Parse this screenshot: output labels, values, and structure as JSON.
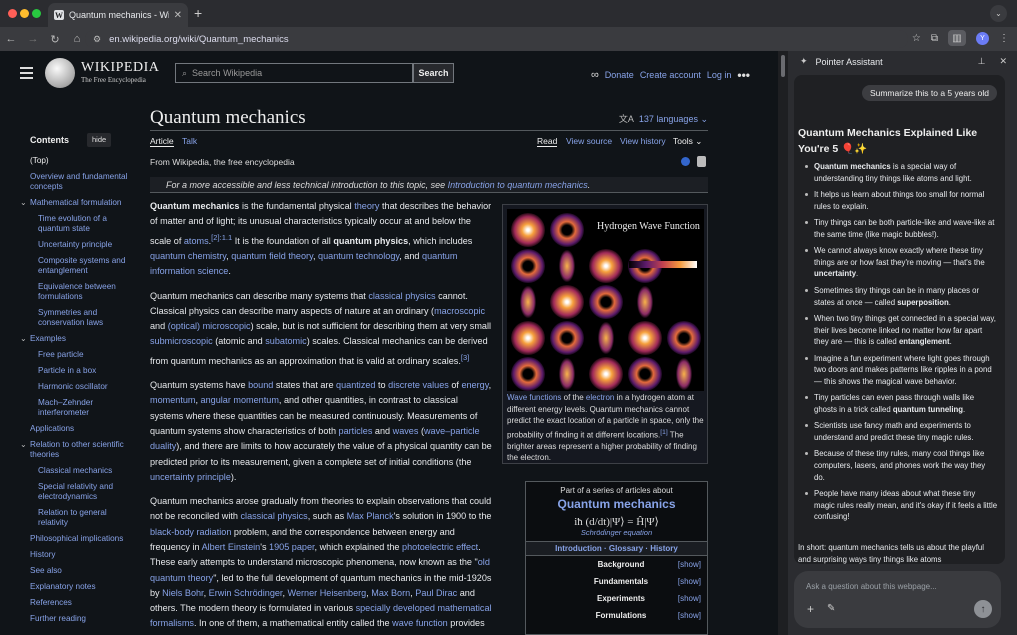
{
  "browser": {
    "tab_title": "Quantum mechanics - Wikipedia",
    "url": "en.wikipedia.org/wiki/Quantum_mechanics",
    "avatar_letter": "Y"
  },
  "wiki": {
    "wordmark": "WIKIPEDIA",
    "tagline": "The Free Encyclopedia",
    "search_placeholder": "Search Wikipedia",
    "search_button": "Search",
    "donate": "Donate",
    "create_account": "Create account",
    "login": "Log in",
    "contents": {
      "title": "Contents",
      "hide": "hide",
      "items": [
        {
          "label": "(Top)",
          "level": 1,
          "top": true
        },
        {
          "label": "Overview and fundamental concepts",
          "level": 1
        },
        {
          "label": "Mathematical formulation",
          "level": 1,
          "chevron": true
        },
        {
          "label": "Time evolution of a quantum state",
          "level": 2
        },
        {
          "label": "Uncertainty principle",
          "level": 2
        },
        {
          "label": "Composite systems and entanglement",
          "level": 2
        },
        {
          "label": "Equivalence between formulations",
          "level": 2
        },
        {
          "label": "Symmetries and conservation laws",
          "level": 2
        },
        {
          "label": "Examples",
          "level": 1,
          "chevron": true
        },
        {
          "label": "Free particle",
          "level": 2
        },
        {
          "label": "Particle in a box",
          "level": 2
        },
        {
          "label": "Harmonic oscillator",
          "level": 2
        },
        {
          "label": "Mach–Zehnder interferometer",
          "level": 2
        },
        {
          "label": "Applications",
          "level": 1
        },
        {
          "label": "Relation to other scientific theories",
          "level": 1,
          "chevron": true
        },
        {
          "label": "Classical mechanics",
          "level": 2
        },
        {
          "label": "Special relativity and electrodynamics",
          "level": 2
        },
        {
          "label": "Relation to general relativity",
          "level": 2
        },
        {
          "label": "Philosophical implications",
          "level": 1
        },
        {
          "label": "History",
          "level": 1
        },
        {
          "label": "See also",
          "level": 1
        },
        {
          "label": "Explanatory notes",
          "level": 1
        },
        {
          "label": "References",
          "level": 1
        },
        {
          "label": "Further reading",
          "level": 1
        }
      ]
    },
    "title": "Quantum mechanics",
    "languages": "137 languages",
    "tabs": {
      "article": "Article",
      "talk": "Talk",
      "read": "Read",
      "view_source": "View source",
      "view_history": "View history",
      "tools": "Tools"
    },
    "from": "From Wikipedia, the free encyclopedia",
    "hatnote_prefix": "For a more accessible and less technical introduction to this topic, see ",
    "hatnote_link": "Introduction to quantum mechanics",
    "hatnote_suffix": ".",
    "figure": {
      "title": "Hydrogen Wave Function",
      "caption_link1": "Wave functions",
      "caption_t1": " of the ",
      "caption_link2": "electron",
      "caption_t2": " in a hydrogen atom at different energy levels. Quantum mechanics cannot predict the exact location of a particle in space, only the probability of finding it at different locations.",
      "caption_ref": "[1]",
      "caption_t3": " The brighter areas represent a higher probability of finding the electron."
    },
    "series": {
      "caption": "Part of a series of articles about",
      "title": "Quantum mechanics",
      "equation": "iħ (d/dt)|Ψ⟩ = Ĥ|Ψ⟩",
      "equation_caption": "Schrödinger equation",
      "nav": "Introduction · Glossary · History",
      "rows": [
        {
          "label": "Background",
          "show": "[show]"
        },
        {
          "label": "Fundamentals",
          "show": "[show]"
        },
        {
          "label": "Experiments",
          "show": "[show]"
        },
        {
          "label": "Formulations",
          "show": "[show]"
        }
      ]
    }
  },
  "assistant": {
    "title": "Pointer Assistant",
    "user_message": "Summarize this to a 5 years old",
    "response_title": "Quantum Mechanics Explained Like You're 5 🎈✨",
    "bullets": [
      {
        "bold": "Quantum mechanics",
        "pre": "",
        "post": " is a special way of understanding tiny things like atoms and light."
      },
      {
        "bold": "",
        "pre": "It helps us learn about things too small for normal rules to explain.",
        "post": ""
      },
      {
        "bold": "",
        "pre": "Tiny things can be both particle-like and wave-like at the same time (like magic bubbles!).",
        "post": ""
      },
      {
        "bold": "uncertainty",
        "pre": "We cannot always know exactly where these tiny things are or how fast they're moving — that's the ",
        "post": "."
      },
      {
        "bold": "superposition",
        "pre": "Sometimes tiny things can be in many places or states at once — called ",
        "post": "."
      },
      {
        "bold": "entanglement",
        "pre": "When two tiny things get connected in a special way, their lives become linked no matter how far apart they are — this is called ",
        "post": "."
      },
      {
        "bold": "",
        "pre": "Imagine a fun experiment where light goes through two doors and makes patterns like ripples in a pond — this shows the magical wave behavior.",
        "post": ""
      },
      {
        "bold": "quantum tunneling",
        "pre": "Tiny particles can even pass through walls like ghosts in a trick called ",
        "post": "."
      },
      {
        "bold": "",
        "pre": "Scientists use fancy math and experiments to understand and predict these tiny magic rules.",
        "post": ""
      },
      {
        "bold": "",
        "pre": "Because of these tiny rules, many cool things like computers, lasers, and phones work the way they do.",
        "post": ""
      },
      {
        "bold": "",
        "pre": "People have many ideas about what these tiny magic rules really mean, and it's okay if it feels a little confusing!",
        "post": ""
      }
    ],
    "summary": "In short: quantum mechanics tells us about the playful and surprising ways tiny things like atoms",
    "input_placeholder": "Ask a question about this webpage..."
  }
}
